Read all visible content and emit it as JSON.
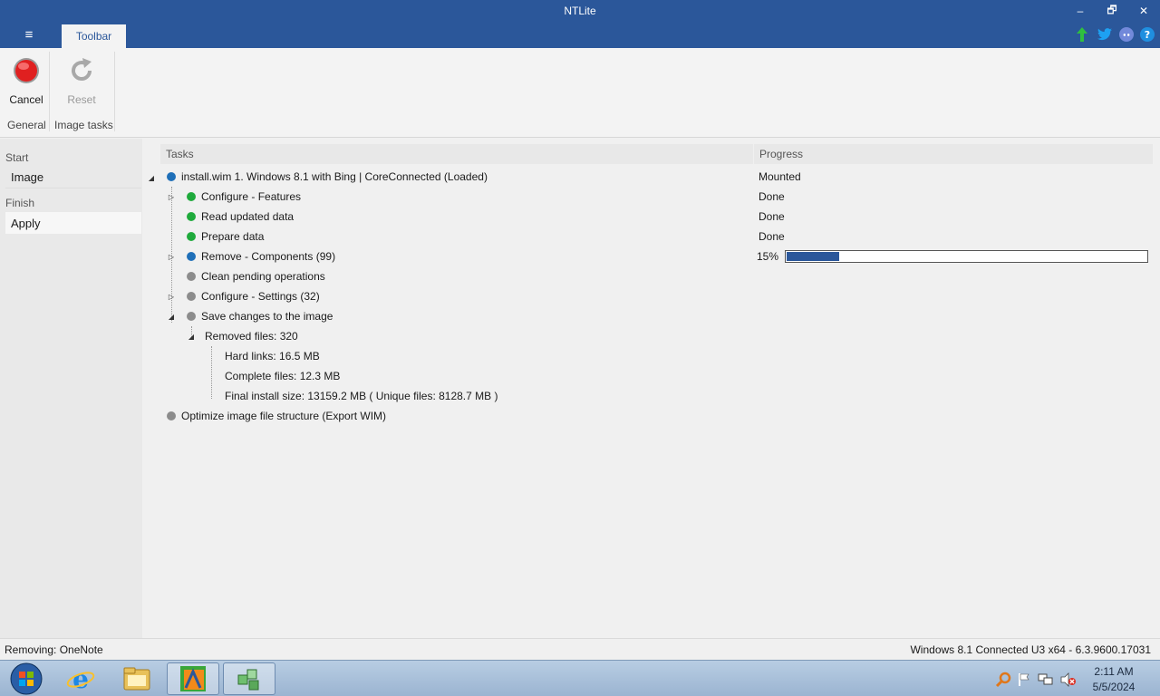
{
  "window": {
    "title": "NTLite",
    "minimize": "‒",
    "restore": "🗗",
    "close": "✕"
  },
  "ribbon": {
    "tab_label": "Toolbar",
    "cancel_label": "Cancel",
    "reset_label": "Reset",
    "group_general": "General",
    "group_image_tasks": "Image tasks"
  },
  "social_icons": [
    "upload-arrow-icon",
    "twitter-icon",
    "discord-icon",
    "help-icon"
  ],
  "nav": {
    "section_start": "Start",
    "item_image": "Image",
    "section_finish": "Finish",
    "item_apply": "Apply"
  },
  "columns": {
    "tasks": "Tasks",
    "progress": "Progress"
  },
  "tasks": {
    "root": {
      "label": "install.wim 1. Windows 8.1 with Bing  |  CoreConnected  (Loaded)",
      "status": "Mounted"
    },
    "t1": {
      "label": "Configure - Features",
      "status": "Done"
    },
    "t2": {
      "label": "Read updated data",
      "status": "Done"
    },
    "t3": {
      "label": "Prepare data",
      "status": "Done"
    },
    "t4": {
      "label": "Remove - Components (99)",
      "status": "15%",
      "progress": 0.15
    },
    "t5": {
      "label": "Clean pending operations"
    },
    "t6": {
      "label": "Configure - Settings (32)"
    },
    "t7": {
      "label": "Save changes to the image"
    },
    "t7a": {
      "label": "Removed files: 320"
    },
    "t7a1": {
      "label": "Hard links: 16.5 MB"
    },
    "t7a2": {
      "label": "Complete files: 12.3 MB"
    },
    "t7a3": {
      "label": "Final install size: 13159.2 MB ( Unique files: 8128.7 MB )"
    },
    "t8": {
      "label": "Optimize image file structure (Export WIM)"
    }
  },
  "status": {
    "left": "Removing: OneNote",
    "right": "Windows 8.1 Connected U3 x64 - 6.3.9600.17031"
  },
  "taskbar": {
    "time": "2:11 AM",
    "date": "5/5/2024"
  },
  "colors": {
    "accent": "#2b579a",
    "done": "#1faa3c",
    "active": "#1f6fb8",
    "pending": "#8c8c8c"
  }
}
